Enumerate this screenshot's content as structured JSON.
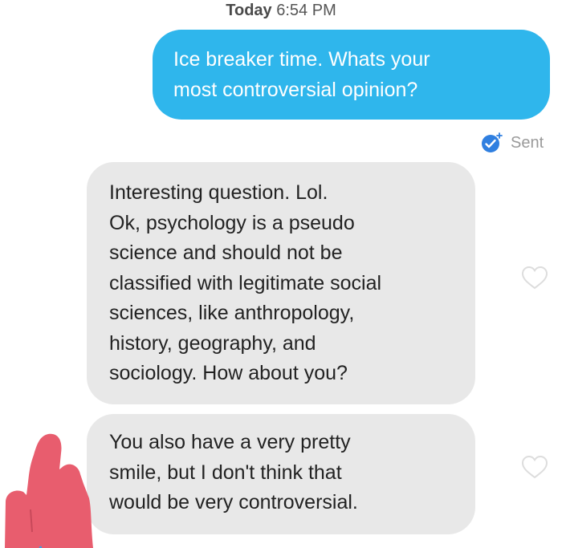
{
  "header": {
    "timestamp_day": "Today",
    "timestamp_time": "6:54 PM"
  },
  "messages": [
    {
      "direction": "sent",
      "lines": [
        "Ice breaker time. Whats your",
        "most controversial opinion?"
      ]
    },
    {
      "direction": "received",
      "lines": [
        "Interesting question. Lol.",
        "Ok, psychology is a pseudo",
        "science and should not be",
        "classified with legitimate social",
        "sciences, like anthropology,",
        "history, geography, and",
        "sociology.  How about you?"
      ]
    },
    {
      "direction": "received",
      "lines": [
        "You also have a very pretty",
        "smile, but I don't think that",
        "would be very controversial."
      ]
    }
  ],
  "status": {
    "label": "Sent",
    "icon": "sent-check-icon"
  },
  "reactions": {
    "icon": "heart-outline-icon"
  },
  "colors": {
    "sent_bubble": "#2fb6ec",
    "received_bubble": "#e8e8e8",
    "status_icon": "#2f7fe0",
    "overlay": "#e85d6e"
  }
}
